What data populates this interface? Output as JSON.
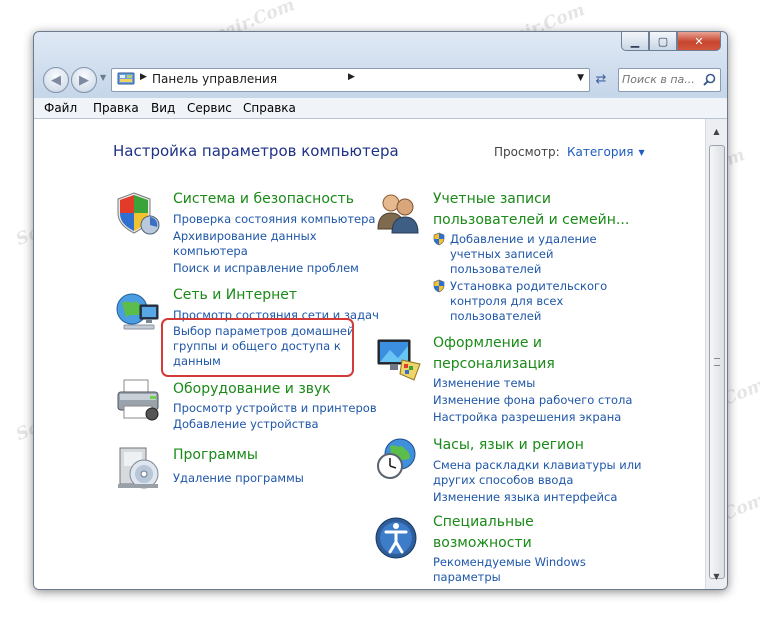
{
  "window": {
    "buttons": {
      "min": "▁",
      "max": "▢",
      "close": "✕"
    }
  },
  "nav": {
    "back_icon": "back-arrow-icon",
    "forward_icon": "forward-arrow-icon",
    "address": {
      "segment": "Панель управления"
    },
    "search": {
      "placeholder": "Поиск в па..."
    }
  },
  "menu": [
    "Файл",
    "Правка",
    "Вид",
    "Сервис",
    "Справка"
  ],
  "page": {
    "heading": "Настройка параметров компьютера",
    "view_label": "Просмотр:",
    "view_value": "Категория"
  },
  "categories_left": [
    {
      "title": "Система и безопасность",
      "icon": "security-shield-icon",
      "links": [
        "Проверка состояния компьютера",
        "Архивирование данных",
        "компьютера",
        "Поиск и исправление проблем"
      ]
    },
    {
      "title": "Сеть и Интернет",
      "icon": "network-globe-icon",
      "links": [
        "Просмотр состояния сети и задач",
        "Выбор параметров домашней",
        "группы и общего доступа к",
        "данным"
      ]
    },
    {
      "title": "Оборудование и звук",
      "icon": "printer-icon",
      "links": [
        "Просмотр устройств и принтеров",
        "Добавление устройства"
      ]
    },
    {
      "title": "Программы",
      "icon": "programs-disc-icon",
      "links": [
        "Удаление программы"
      ]
    }
  ],
  "categories_right": [
    {
      "title_lines": [
        "Учетные записи",
        "пользователей и семейн..."
      ],
      "icon": "users-icon",
      "links": [
        "Добавление и удаление",
        "учетных записей",
        "пользователей",
        "Установка родительского",
        "контроля для всех",
        "пользователей"
      ]
    },
    {
      "title_lines": [
        "Оформление и",
        "персонализация"
      ],
      "icon": "appearance-monitor-icon",
      "links": [
        "Изменение темы",
        "Изменение фона рабочего стола",
        "Настройка разрешения экрана"
      ]
    },
    {
      "title_lines": [
        "Часы, язык и регион"
      ],
      "icon": "clock-globe-icon",
      "links": [
        "Смена раскладки клавиатуры или",
        "других способов ввода",
        "Изменение языка интерфейса"
      ]
    },
    {
      "title_lines": [
        "Специальные",
        "возможности"
      ],
      "icon": "accessibility-icon",
      "links": [
        "Рекомендуемые Windows",
        "параметры"
      ]
    }
  ],
  "watermark": "Soringpcrepair.Com",
  "colors": {
    "link": "#1e56a8",
    "category": "#1a8a18",
    "highlight": "#d33a38"
  }
}
